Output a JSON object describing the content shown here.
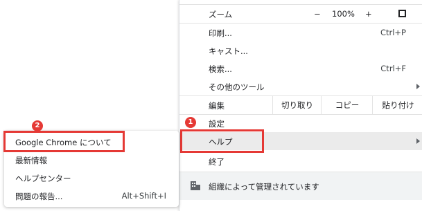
{
  "menu": {
    "zoom": {
      "label": "ズーム",
      "minus": "−",
      "level": "100%",
      "plus": "+"
    },
    "print": {
      "label": "印刷...",
      "shortcut": "Ctrl+P"
    },
    "cast": {
      "label": "キャスト..."
    },
    "find": {
      "label": "検索...",
      "shortcut": "Ctrl+F"
    },
    "more_tools": {
      "label": "その他のツール"
    },
    "edit": {
      "label": "編集",
      "cut": "切り取り",
      "copy": "コピー",
      "paste": "貼り付け"
    },
    "settings": {
      "label": "設定"
    },
    "help": {
      "label": "ヘルプ"
    },
    "exit": {
      "label": "終了"
    },
    "managed": {
      "label": "組織によって管理されています"
    }
  },
  "submenu": {
    "about": {
      "label": "Google Chrome について"
    },
    "whats_new": {
      "label": "最新情報"
    },
    "help_center": {
      "label": "ヘルプセンター"
    },
    "report_issue": {
      "label": "問題の報告...",
      "shortcut": "Alt+Shift+I"
    }
  },
  "annotations": {
    "step1": "1",
    "step2": "2"
  },
  "colors": {
    "highlight": "#e53935",
    "hover": "#ebebeb",
    "managed_bg": "#f1f3f4"
  }
}
